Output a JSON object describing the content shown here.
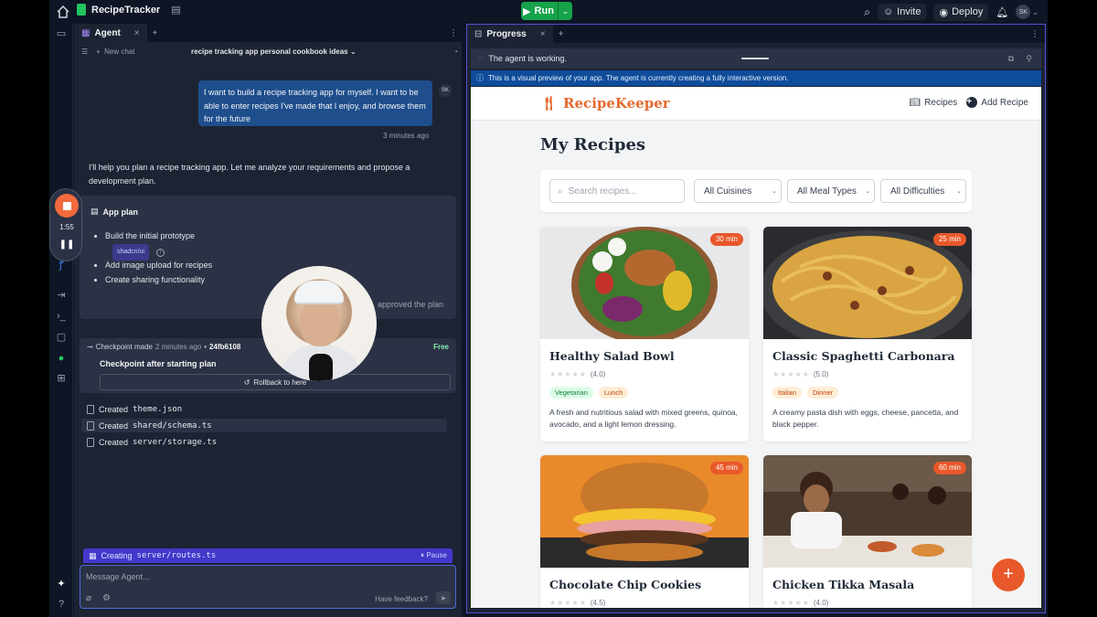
{
  "topbar": {
    "project_name": "RecipeTracker",
    "run_label": "Run",
    "invite_label": "Invite",
    "deploy_label": "Deploy",
    "avatar_initials": "SK"
  },
  "agent_tab": {
    "label": "Agent"
  },
  "chat": {
    "new_chat": "New chat",
    "title": "recipe tracking app personal cookbook ideas",
    "user_message": "I want to build a recipe tracking app for myself. I want to be able to enter recipes I've made that I enjoy, and browse them for the future",
    "user_initials": "SK",
    "timestamp": "3 minutes ago",
    "assistant_message": "I'll help you plan a recipe tracking app. Let me analyze your requirements and propose a development plan."
  },
  "plan": {
    "title": "App plan",
    "items": [
      "Build the initial prototype",
      "Add image upload for recipes",
      "Create sharing functionality"
    ],
    "chip": "shadcn/ui",
    "approved": "approved the plan"
  },
  "checkpoint": {
    "made_label": "Checkpoint made",
    "time": "2 minutes ago",
    "hash": "24fb6108",
    "cost": "Free",
    "title": "Checkpoint after starting plan",
    "rollback": "Rollback to here"
  },
  "files": [
    {
      "prefix": "Created",
      "name": "theme.json"
    },
    {
      "prefix": "Created",
      "name": "shared/schema.ts"
    },
    {
      "prefix": "Created",
      "name": "server/storage.ts"
    }
  ],
  "creating": {
    "prefix": "Creating",
    "name": "server/routes.ts",
    "pause": "Pause"
  },
  "composer": {
    "placeholder": "Message Agent...",
    "feedback": "Have feedback?"
  },
  "recorder": {
    "time": "1:55"
  },
  "progress_tab": {
    "label": "Progress"
  },
  "status": {
    "working": "The agent is working.",
    "notice": "This is a visual preview of your app. The agent is currently creating a fully interactive version."
  },
  "preview": {
    "brand": "RecipeKeeper",
    "nav_recipes": "Recipes",
    "nav_add": "Add Recipe",
    "heading": "My Recipes",
    "search_placeholder": "Search recipes...",
    "filters": [
      "All Cuisines",
      "All Meal Types",
      "All Difficulties"
    ],
    "cards": [
      {
        "title": "Healthy Salad Bowl",
        "time": "30 min",
        "rating": "(4.0)",
        "tags": [
          "Vegetarian",
          "Lunch"
        ],
        "desc": "A fresh and nutritious salad with mixed greens, quinoa, avocado, and a light lemon dressing."
      },
      {
        "title": "Classic Spaghetti Carbonara",
        "time": "25 min",
        "rating": "(5.0)",
        "tags": [
          "Italian",
          "Dinner"
        ],
        "desc": "A creamy pasta dish with eggs, cheese, pancetta, and black pepper."
      },
      {
        "title": "Chocolate Chip Cookies",
        "time": "45 min",
        "rating": "(4.5)",
        "tags": [],
        "desc": ""
      },
      {
        "title": "Chicken Tikka Masala",
        "time": "60 min",
        "rating": "(4.0)",
        "tags": [],
        "desc": ""
      }
    ],
    "fab": "+"
  },
  "colors": {
    "accent": "#e9582a",
    "run": "#16a34a",
    "user_bubble": "#1e4e8c",
    "creating": "#4338ca"
  }
}
